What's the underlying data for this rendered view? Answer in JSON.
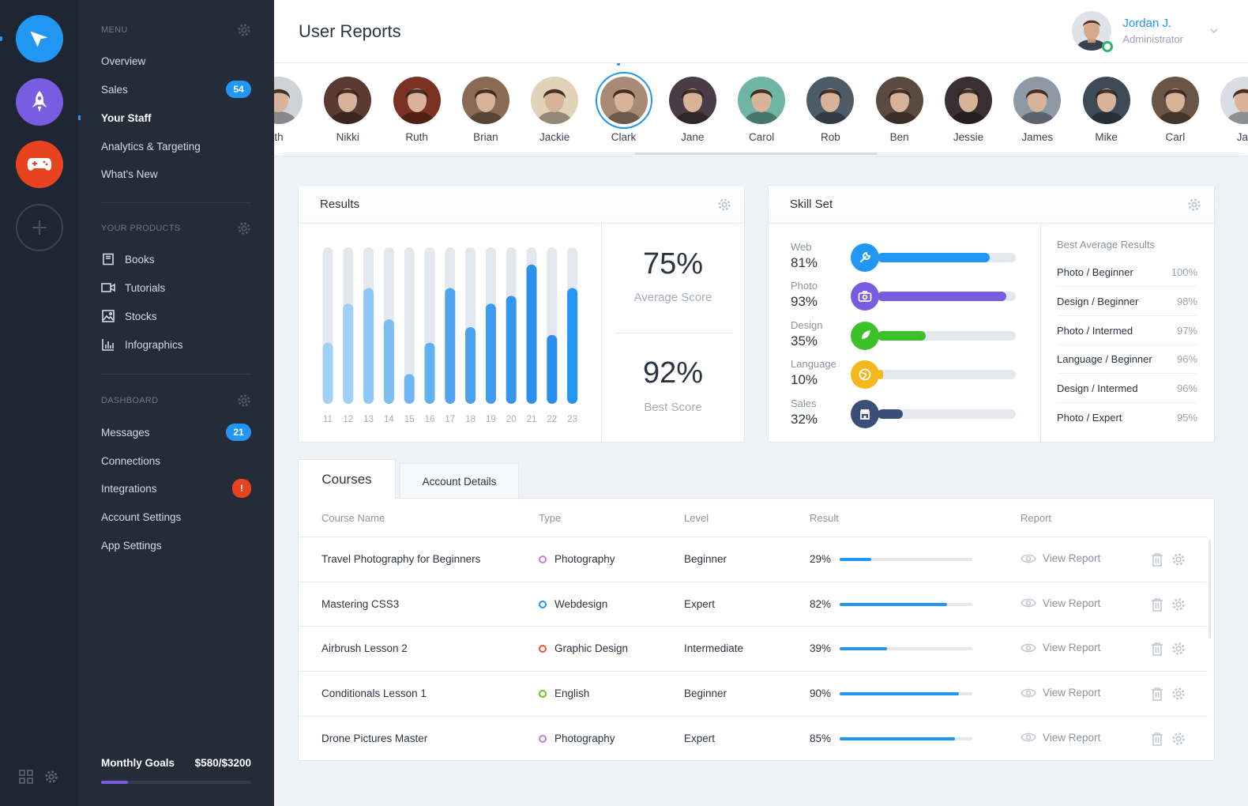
{
  "header": {
    "title": "User Reports",
    "user_name": "Jordan J.",
    "user_role": "Administrator"
  },
  "menu": {
    "title": "MENU",
    "items": [
      {
        "label": "Overview"
      },
      {
        "label": "Sales",
        "badge": "54"
      },
      {
        "label": "Your Staff",
        "active": true
      },
      {
        "label": "Analytics & Targeting"
      },
      {
        "label": "What's New"
      }
    ]
  },
  "products": {
    "title": "YOUR PRODUCTS",
    "items": [
      {
        "label": "Books",
        "icon": "book-icon"
      },
      {
        "label": "Tutorials",
        "icon": "video-icon"
      },
      {
        "label": "Stocks",
        "icon": "image-icon"
      },
      {
        "label": "Infographics",
        "icon": "bar-chart-icon"
      }
    ]
  },
  "dashboard": {
    "title": "DASHBOARD",
    "items": [
      {
        "label": "Messages",
        "badge": "21"
      },
      {
        "label": "Connections"
      },
      {
        "label": "Integrations",
        "badge": "!"
      },
      {
        "label": "Account Settings"
      },
      {
        "label": "App Settings"
      }
    ]
  },
  "goals": {
    "label": "Monthly Goals",
    "value": "$580/$3200",
    "progress": 0.18
  },
  "people": [
    {
      "name": "Ruth",
      "partial": "th",
      "color": "#cfd2d6"
    },
    {
      "name": "Nikki",
      "color": "#5a3a30"
    },
    {
      "name": "Ruth",
      "color": "#7a3322"
    },
    {
      "name": "Brian",
      "color": "#8a6a52"
    },
    {
      "name": "Jackie",
      "color": "#e2d2b8"
    },
    {
      "name": "Clark",
      "color": "#a88a76",
      "selected": true
    },
    {
      "name": "Jane",
      "color": "#4a3c44"
    },
    {
      "name": "Carol",
      "color": "#6fb5a6"
    },
    {
      "name": "Rob",
      "color": "#4d5a68"
    },
    {
      "name": "Ben",
      "color": "#5b4a40"
    },
    {
      "name": "Jessie",
      "color": "#3a3034"
    },
    {
      "name": "James",
      "color": "#8d9aa6"
    },
    {
      "name": "Mike",
      "color": "#3e4a55"
    },
    {
      "name": "Carl",
      "color": "#6a5444"
    },
    {
      "name": "Jan",
      "partial": "Jar",
      "color": "#d9dde2"
    }
  ],
  "results": {
    "title": "Results",
    "chart_data": {
      "type": "bar",
      "categories": [
        "11",
        "12",
        "13",
        "14",
        "15",
        "16",
        "17",
        "18",
        "19",
        "20",
        "21",
        "22",
        "23"
      ],
      "values": [
        39,
        64,
        74,
        54,
        19,
        39,
        74,
        49,
        64,
        69,
        89,
        44,
        74
      ],
      "ylim": [
        0,
        100
      ],
      "track_color": "#e4e8ee",
      "colors": [
        "#9fd1f7",
        "#9fd1f7",
        "#8fc8f5",
        "#7cbdf2",
        "#6fb7f2",
        "#62b0f0",
        "#4fa6ef",
        "#4aa2ee",
        "#3f9bef",
        "#3696ee",
        "#2c8fed",
        "#2a8eed",
        "#2196f3"
      ]
    },
    "average": {
      "value": "75%",
      "label": "Average Score"
    },
    "best": {
      "value": "92%",
      "label": "Best Score"
    }
  },
  "skills": {
    "title": "Skill Set",
    "items": [
      {
        "name": "Web",
        "pct": "81%",
        "value": 0.81,
        "color": "#2196f3",
        "icon": "wrench-icon"
      },
      {
        "name": "Photo",
        "pct": "93%",
        "value": 0.93,
        "color": "#7a5ce0",
        "icon": "camera-icon"
      },
      {
        "name": "Design",
        "pct": "35%",
        "value": 0.35,
        "color": "#3cc12a",
        "icon": "feather-icon"
      },
      {
        "name": "Language",
        "pct": "10%",
        "value": 0.04,
        "color": "#f4b81c",
        "icon": "globe-icon"
      },
      {
        "name": "Sales",
        "pct": "32%",
        "value": 0.18,
        "color": "#3a4f78",
        "icon": "store-icon"
      }
    ],
    "best_title": "Best Average Results",
    "best": [
      {
        "name": "Photo / Beginner",
        "value": "100%"
      },
      {
        "name": "Design / Beginner",
        "value": "98%"
      },
      {
        "name": "Photo / Intermed",
        "value": "97%"
      },
      {
        "name": "Language / Beginner",
        "value": "96%"
      },
      {
        "name": "Design / Intermed",
        "value": "96%"
      },
      {
        "name": "Photo / Expert",
        "value": "95%"
      }
    ]
  },
  "tabs": {
    "active": "Courses",
    "inactive": "Account Details"
  },
  "table": {
    "headers": {
      "name": "Course Name",
      "type": "Type",
      "level": "Level",
      "result": "Result",
      "report": "Report"
    },
    "view_label": "View Report",
    "rows": [
      {
        "name": "Travel Photography for Beginners",
        "type": "Photography",
        "type_color": "#c77fd6",
        "level": "Beginner",
        "result": "29%",
        "value": 0.24
      },
      {
        "name": "Mastering CSS3",
        "type": "Webdesign",
        "type_color": "#2196f3",
        "level": "Expert",
        "result": "82%",
        "value": 0.81
      },
      {
        "name": "Airbrush Lesson 2",
        "type": "Graphic Design",
        "type_color": "#e8563f",
        "level": "Intermediate",
        "result": "39%",
        "value": 0.36
      },
      {
        "name": "Conditionals Lesson 1",
        "type": "English",
        "type_color": "#6cc11f",
        "level": "Beginner",
        "result": "90%",
        "value": 0.9
      },
      {
        "name": "Drone Pictures Master",
        "type": "Photography",
        "type_color": "#c77fd6",
        "level": "Expert",
        "result": "85%",
        "value": 0.87
      }
    ]
  }
}
